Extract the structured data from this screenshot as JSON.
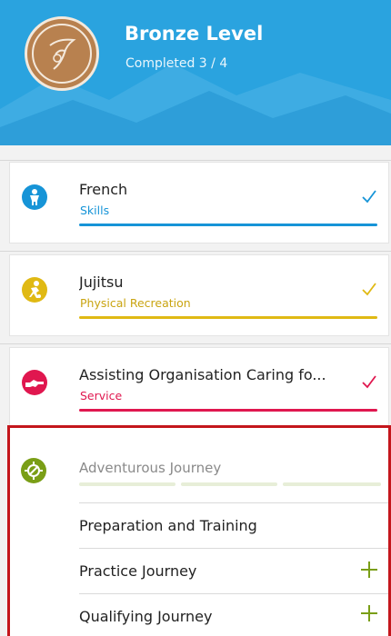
{
  "level": {
    "title": "Bronze Level",
    "progress_text": "Completed 3 / 4"
  },
  "sections": [
    {
      "title": "French",
      "subtitle": "Skills",
      "color": "#1694d7",
      "icon": "person-skills-icon",
      "status": "completed"
    },
    {
      "title": "Jujitsu",
      "subtitle": "Physical Recreation",
      "color": "#e0b913",
      "icon": "running-person-icon",
      "status": "completed"
    },
    {
      "title": "Assisting Organisation Caring fo...",
      "subtitle": "Service",
      "color": "#e0174f",
      "icon": "handshake-icon",
      "status": "completed"
    }
  ],
  "adventurous": {
    "title": "Adventurous Journey",
    "color": "#7a9e16",
    "icon": "compass-icon",
    "items": [
      {
        "label": "Preparation and Training",
        "action": ""
      },
      {
        "label": "Practice Journey",
        "action": "add"
      },
      {
        "label": "Qualifying Journey",
        "action": "add"
      }
    ]
  }
}
